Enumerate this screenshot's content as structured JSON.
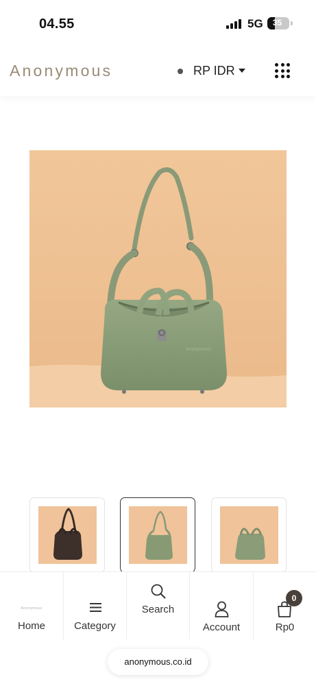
{
  "status_bar": {
    "time": "04.55",
    "network": "5G",
    "battery_level": "35",
    "battery_fraction": 0.35,
    "signal_icon": "signal-bars-icon"
  },
  "header": {
    "brand": "Anonymous",
    "currency": "RP IDR",
    "currency_icon": "chevron-down-icon",
    "menu_icon": "grid-dots-icon"
  },
  "product": {
    "image_description_icon": "green-handbag-photo",
    "watermark": "Anonymous",
    "colors": {
      "background": "#efc597",
      "bag": "#889c76"
    }
  },
  "thumbnails": [
    {
      "icon": "black-handbag-thumbnail",
      "selected": false
    },
    {
      "icon": "green-handbag-thumbnail",
      "selected": true
    },
    {
      "icon": "green-handbag-side-thumbnail",
      "selected": false
    }
  ],
  "bottom_nav": {
    "home": {
      "label": "Home",
      "icon": "home-logo-icon",
      "logo_text": "Anonymous"
    },
    "category": {
      "label": "Category",
      "icon": "hamburger-icon"
    },
    "search": {
      "label": "Search",
      "icon": "search-icon"
    },
    "account": {
      "label": "Account",
      "icon": "user-icon"
    },
    "cart": {
      "label": "Rp0",
      "icon": "shopping-bag-icon",
      "badge": "0"
    }
  },
  "browser": {
    "url": "anonymous.co.id"
  }
}
